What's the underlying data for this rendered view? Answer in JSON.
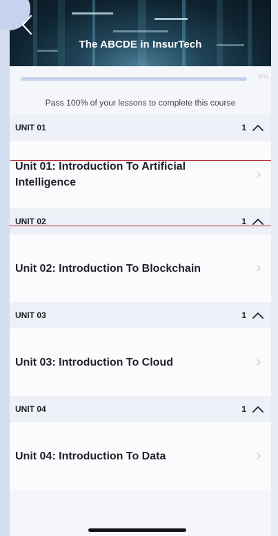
{
  "header": {
    "title": "The ABCDE in InsurTech",
    "back_icon": "chevron-left-icon"
  },
  "progress": {
    "value": 0,
    "label": "0%"
  },
  "hint": "Pass 100% of your lessons to complete this course",
  "units": [
    {
      "label": "UNIT 01",
      "count": "1",
      "expanded": true,
      "lesson": "Unit 01: Introduction To Artificial Intelligence"
    },
    {
      "label": "UNIT 02",
      "count": "1",
      "expanded": true,
      "lesson": "Unit 02: Introduction To Blockchain"
    },
    {
      "label": "UNIT 03",
      "count": "1",
      "expanded": true,
      "lesson": "Unit 03: Introduction To Cloud"
    },
    {
      "label": "UNIT 04",
      "count": "1",
      "expanded": true,
      "lesson": "Unit 04: Introduction To Data"
    }
  ],
  "colors": {
    "accent": "#3b6fb6",
    "highlight": "#b32228"
  }
}
